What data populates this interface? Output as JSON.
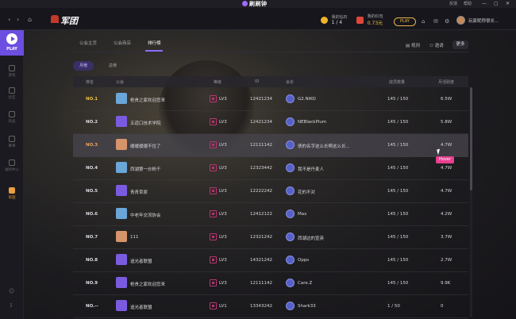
{
  "app": {
    "brand": "刷刷钟",
    "minimize": "—",
    "maximize": "▢",
    "close": "✕",
    "feedback": "反馈",
    "help": "帮助"
  },
  "header": {
    "logo_text": "军团",
    "gems_label": "我的钻石",
    "gems_value": "1 / 4",
    "coins_label": "我的红包",
    "coins_value": "0.73元",
    "vip_label": "PLAY",
    "username": "玩家昵称很长..."
  },
  "sidebar": {
    "play_label": "PLAY",
    "items": [
      {
        "label": "游戏",
        "icon": "game-icon",
        "active": false
      },
      {
        "label": "社区",
        "icon": "community-icon",
        "active": false
      },
      {
        "label": "饰品",
        "icon": "skin-icon",
        "active": false
      },
      {
        "label": "赛事",
        "icon": "trophy-icon",
        "active": false
      },
      {
        "label": "福利中心",
        "icon": "gift-icon",
        "active": false
      },
      {
        "label": "军团",
        "icon": "legion-icon",
        "active": true
      }
    ]
  },
  "tabs": [
    {
      "label": "公会主页",
      "active": false
    },
    {
      "label": "公会商店",
      "active": false
    },
    {
      "label": "排行榜",
      "active": true
    }
  ],
  "actions": {
    "rules": "规则",
    "invite": "邀请",
    "more": "更多"
  },
  "subtabs": {
    "monthly": "月榜",
    "total": "总榜"
  },
  "columns": {
    "rank": "排名",
    "club": "公会",
    "level": "等级",
    "id": "ID",
    "leader": "会长",
    "members": "成员数量",
    "active": "月活跃度"
  },
  "rows": [
    {
      "rank": "NO.1",
      "name": "枪贵之家欢迎您来",
      "level": "LV3",
      "id": "12421234",
      "leader": "G2.NIKO",
      "members": "145 / 150",
      "active": "6.5W",
      "icon_color": "#6aa6d8",
      "rank_color": "#f0c040"
    },
    {
      "rank": "NO.2",
      "name": "五道口技术学院",
      "level": "LV3",
      "id": "12421234",
      "leader": "NEBlackPlum",
      "members": "145 / 150",
      "active": "5.8W",
      "icon_color": "#7a5be0",
      "rank_color": "#dcdce4"
    },
    {
      "rank": "NO.3",
      "name": "缓缓缓缓不住了",
      "level": "LV3",
      "id": "12111142",
      "leader": "债的名字这么长啊这么长...",
      "members": "145 / 150",
      "active": "4.7W",
      "icon_color": "#d6946a",
      "rank_color": "#e8a060"
    },
    {
      "rank": "NO.4",
      "name": "西湖第一炒粉干",
      "level": "LV3",
      "id": "12323442",
      "leader": "我不是丹麦人",
      "members": "145 / 150",
      "active": "4.7W",
      "icon_color": "#6aa6d8",
      "rank_color": "#dcdce4"
    },
    {
      "rank": "NO.5",
      "name": "青青草原",
      "level": "LV3",
      "id": "12222242",
      "leader": "花的不对",
      "members": "145 / 150",
      "active": "4.7W",
      "icon_color": "#7a5be0",
      "rank_color": "#dcdce4"
    },
    {
      "rank": "NO.6",
      "name": "中老年交流协会",
      "level": "LV3",
      "id": "12412122",
      "leader": "Max",
      "members": "145 / 150",
      "active": "4.2W",
      "icon_color": "#6aa6d8",
      "rank_color": "#dcdce4"
    },
    {
      "rank": "NO.7",
      "name": "111",
      "level": "LV3",
      "id": "12321242",
      "leader": "西湖边的宣英",
      "members": "145 / 150",
      "active": "3.7W",
      "icon_color": "#d6946a",
      "rank_color": "#dcdce4"
    },
    {
      "rank": "NO.8",
      "name": "追光者联盟",
      "level": "LV3",
      "id": "14321242",
      "leader": "Opps",
      "members": "145 / 150",
      "active": "2.7W",
      "icon_color": "#7a5be0",
      "rank_color": "#dcdce4"
    },
    {
      "rank": "NO.9",
      "name": "枪贵之家欢迎您来",
      "level": "LV3",
      "id": "12111142",
      "leader": "Care.Z",
      "members": "145 / 150",
      "active": "9.9K",
      "icon_color": "#7a5be0",
      "rank_color": "#dcdce4"
    },
    {
      "rank": "NO.--",
      "name": "追光者联盟",
      "level": "LV1",
      "id": "13343242",
      "leader": "Shark33",
      "members": "1 / 50",
      "active": "0",
      "icon_color": "#7a5be0",
      "rank_color": "#dcdce4"
    }
  ],
  "tooltip": "Hover"
}
